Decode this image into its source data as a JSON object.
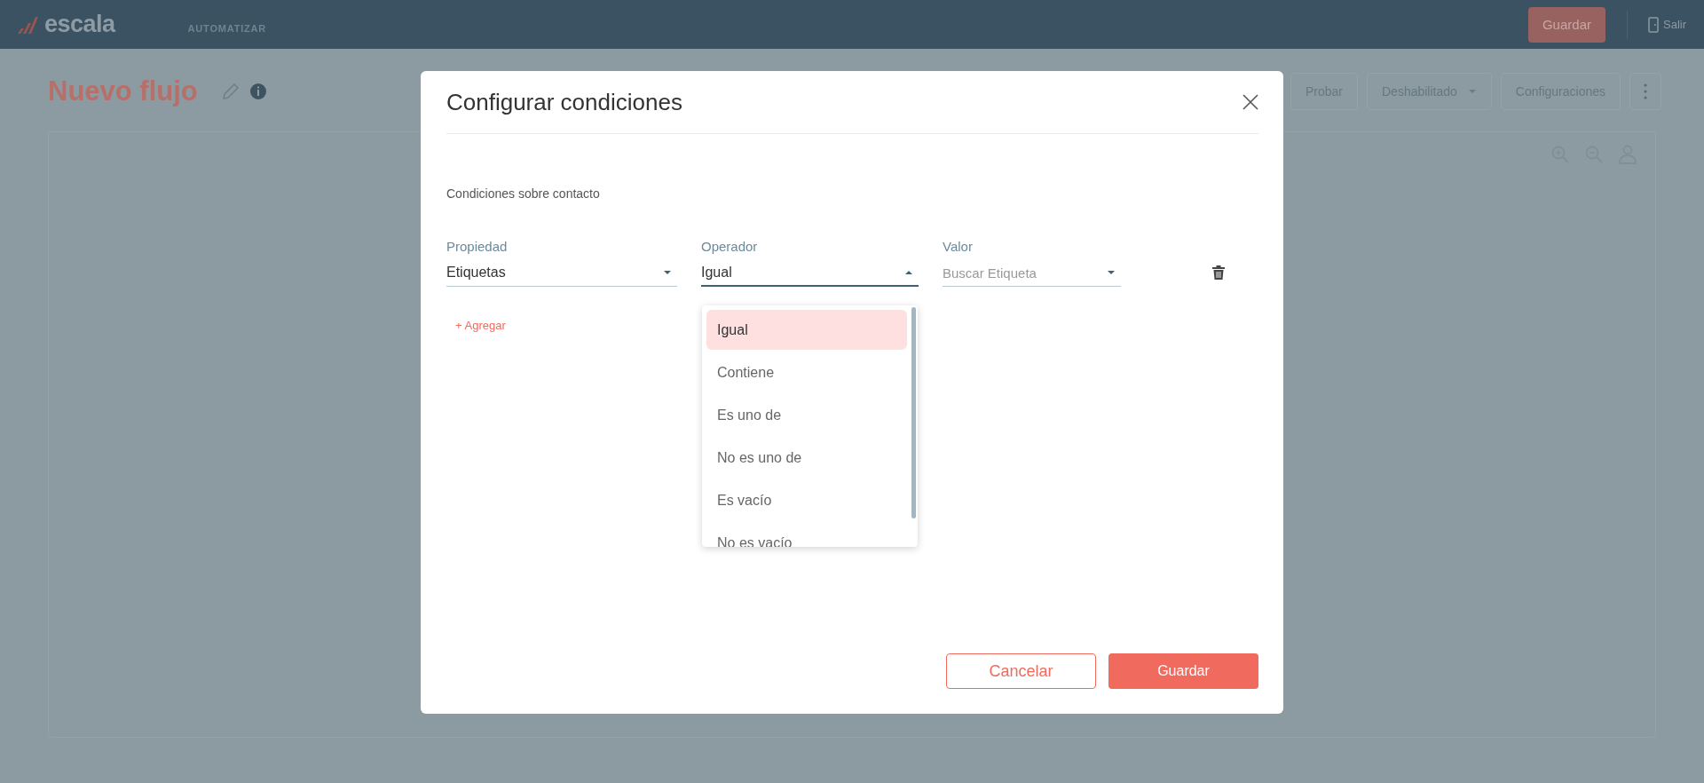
{
  "top_bar": {
    "logo": "escala",
    "nav": [
      "AUTOMATIZAR"
    ],
    "save_button": "Guardar",
    "exit_link": "Salir"
  },
  "page": {
    "title": "Nuevo flujo",
    "actions": [
      {
        "kind": "button",
        "label": "Probar"
      },
      {
        "kind": "dropdown",
        "label": "Deshabilitado"
      },
      {
        "kind": "button",
        "label": "Configuraciones"
      },
      {
        "kind": "menu"
      }
    ]
  },
  "dialog": {
    "title": "Configurar condiciones",
    "section_label": "Condiciones sobre contacto",
    "fields": [
      {
        "label": "Propiedad",
        "value": "Etiquetas",
        "expanded": false
      },
      {
        "label": "Operador",
        "value": "Igual",
        "expanded": true,
        "options": [
          {
            "label": "Igual",
            "selected": true
          },
          {
            "label": "Contiene",
            "selected": false
          },
          {
            "label": "Es uno de",
            "selected": false
          },
          {
            "label": "No es uno de",
            "selected": false
          },
          {
            "label": "Es vacío",
            "selected": false
          },
          {
            "label": "No es vacío",
            "selected": false
          }
        ]
      },
      {
        "label": "Valor",
        "placeholder": "Buscar Etiqueta",
        "expanded": false
      }
    ],
    "add_link": "+ Agregar",
    "buttons": [
      {
        "kind": "secondary",
        "label": "Cancelar"
      },
      {
        "kind": "primary",
        "label": "Guardar"
      }
    ]
  }
}
